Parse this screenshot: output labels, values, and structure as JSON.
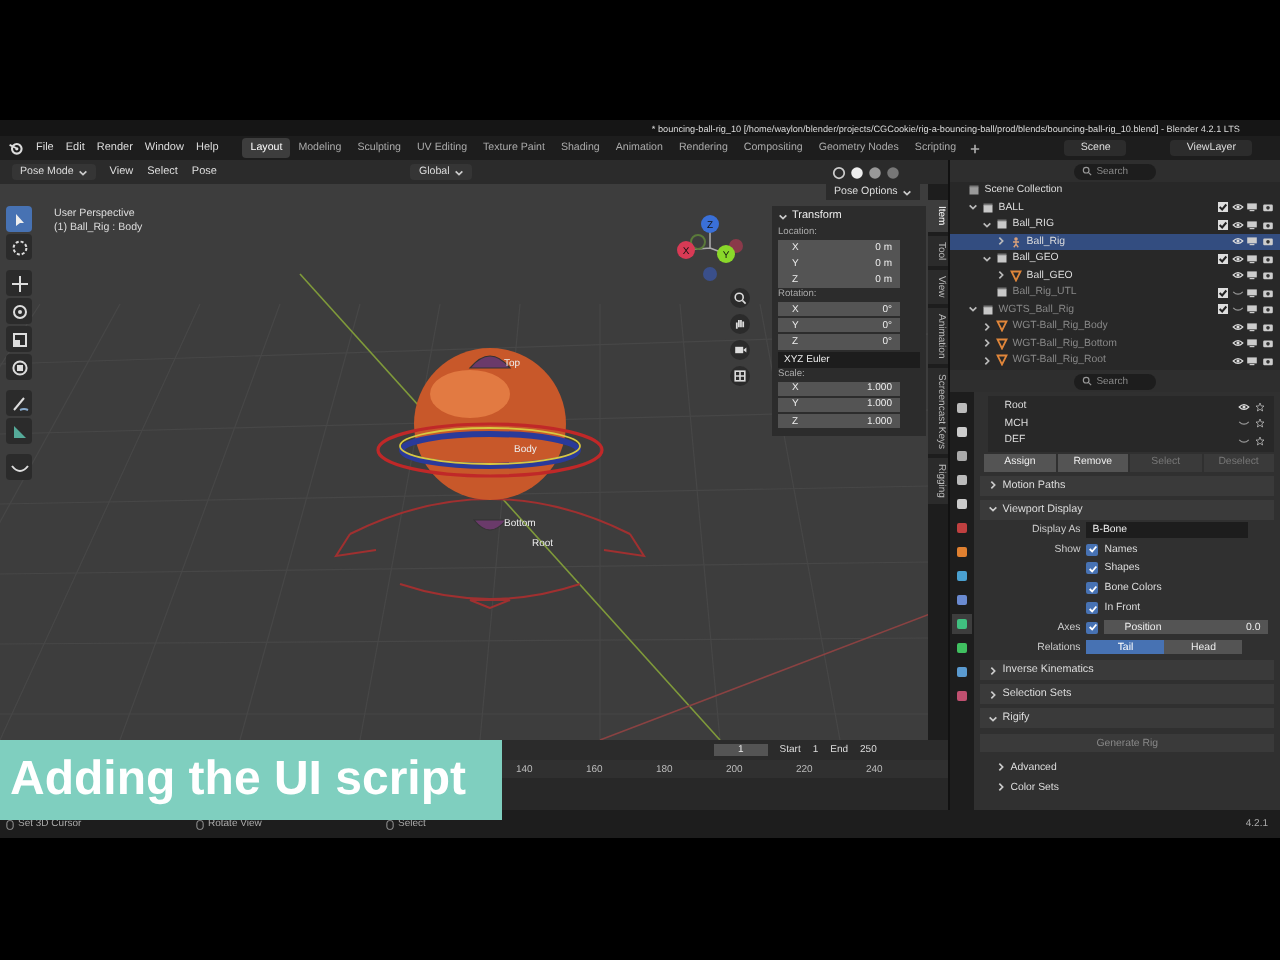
{
  "window": {
    "title": "* bouncing-ball-rig_10 [/home/waylon/blender/projects/CGCookie/rig-a-bouncing-ball/prod/blends/bouncing-ball-rig_10.blend] - Blender 4.2.1 LTS"
  },
  "menu": [
    "File",
    "Edit",
    "Render",
    "Window",
    "Help"
  ],
  "workspaces": [
    {
      "label": "Layout",
      "selected": true
    },
    {
      "label": "Modeling",
      "selected": false
    },
    {
      "label": "Sculpting",
      "selected": false
    },
    {
      "label": "UV Editing",
      "selected": false
    },
    {
      "label": "Texture Paint",
      "selected": false
    },
    {
      "label": "Shading",
      "selected": false
    },
    {
      "label": "Animation",
      "selected": false
    },
    {
      "label": "Rendering",
      "selected": false
    },
    {
      "label": "Compositing",
      "selected": false
    },
    {
      "label": "Geometry Nodes",
      "selected": false
    },
    {
      "label": "Scripting",
      "selected": false
    }
  ],
  "scene": "Scene",
  "view_layer": "ViewLayer",
  "header": {
    "mode": "Pose Mode",
    "menus": [
      "View",
      "Select",
      "Pose"
    ],
    "orientation": "Global",
    "options": "Pose Options"
  },
  "viewport": {
    "overlay": [
      "User Perspective",
      "(1) Ball_Rig : Body"
    ],
    "bone_labels": [
      "Top",
      "Body",
      "Bottom",
      "Root"
    ],
    "gizmo_axes": [
      "Z",
      "X",
      "Y"
    ]
  },
  "transform": {
    "title": "Transform",
    "groups": [
      {
        "label": "Location:",
        "fields": [
          {
            "axis": "X",
            "value": "0 m"
          },
          {
            "axis": "Y",
            "value": "0 m"
          },
          {
            "axis": "Z",
            "value": "0 m"
          }
        ]
      },
      {
        "label": "Rotation:",
        "fields": [
          {
            "axis": "X",
            "value": "0°"
          },
          {
            "axis": "Y",
            "value": "0°"
          },
          {
            "axis": "Z",
            "value": "0°"
          }
        ],
        "mode": "XYZ Euler"
      },
      {
        "label": "Scale:",
        "fields": [
          {
            "axis": "X",
            "value": "1.000"
          },
          {
            "axis": "Y",
            "value": "1.000"
          },
          {
            "axis": "Z",
            "value": "1.000"
          }
        ]
      }
    ]
  },
  "sidebar_tabs": [
    {
      "label": "Item",
      "selected": true
    },
    {
      "label": "Tool",
      "selected": false
    },
    {
      "label": "View",
      "selected": false
    },
    {
      "label": "Animation",
      "selected": false
    },
    {
      "label": "Screencast Keys",
      "selected": false
    },
    {
      "label": "Rigging",
      "selected": false
    }
  ],
  "outliner": {
    "search_placeholder": "Search",
    "items": [
      {
        "label": "Scene Collection",
        "kind": "scene",
        "selected": false,
        "disabled": false,
        "children": [
          {
            "label": "BALL",
            "kind": "collection",
            "selected": false,
            "disabled": false,
            "checked": true,
            "visible": true,
            "expanded": true,
            "children": [
              {
                "label": "Ball_RIG",
                "kind": "collection",
                "selected": false,
                "disabled": false,
                "checked": true,
                "visible": true,
                "expanded": true,
                "children": [
                  {
                    "label": "Ball_Rig",
                    "kind": "armature",
                    "selected": true,
                    "disabled": false,
                    "visible": true,
                    "expanded": false
                  }
                ]
              },
              {
                "label": "Ball_GEO",
                "kind": "collection",
                "selected": false,
                "disabled": false,
                "checked": true,
                "visible": true,
                "expanded": true,
                "children": [
                  {
                    "label": "Ball_GEO",
                    "kind": "mesh",
                    "selected": false,
                    "disabled": false,
                    "visible": true,
                    "expanded": false
                  }
                ]
              },
              {
                "label": "Ball_Rig_UTL",
                "kind": "collection",
                "selected": false,
                "disabled": true,
                "checked": true,
                "visible": false
              }
            ]
          },
          {
            "label": "WGTS_Ball_Rig",
            "kind": "collection",
            "selected": false,
            "disabled": true,
            "checked": true,
            "visible": false,
            "expanded": true,
            "children": [
              {
                "label": "WGT-Ball_Rig_Body",
                "kind": "mesh",
                "selected": false,
                "disabled": true,
                "visible": true,
                "expanded": false
              },
              {
                "label": "WGT-Ball_Rig_Bottom",
                "kind": "mesh",
                "selected": false,
                "disabled": true,
                "visible": true,
                "expanded": false
              },
              {
                "label": "WGT-Ball_Rig_Root",
                "kind": "mesh",
                "selected": false,
                "disabled": true,
                "visible": true,
                "expanded": false
              }
            ]
          }
        ]
      }
    ]
  },
  "properties": {
    "search_placeholder": "Search",
    "bone_collections": [
      {
        "label": "Root",
        "visible": true
      },
      {
        "label": "MCH",
        "visible": false
      },
      {
        "label": "DEF",
        "visible": false
      }
    ],
    "collection_buttons": [
      {
        "label": "Assign",
        "disabled": false
      },
      {
        "label": "Remove",
        "disabled": false
      },
      {
        "label": "Select",
        "disabled": true
      },
      {
        "label": "Deselect",
        "disabled": true
      }
    ],
    "panels": [
      {
        "title": "Motion Paths",
        "expanded": false
      },
      {
        "title": "Viewport Display",
        "expanded": true,
        "display_as": {
          "label": "Display As",
          "value": "B-Bone"
        },
        "show_label": "Show",
        "show": [
          {
            "label": "Names",
            "checked": true
          },
          {
            "label": "Shapes",
            "checked": true
          },
          {
            "label": "Bone Colors",
            "checked": true
          },
          {
            "label": "In Front",
            "checked": true
          }
        ],
        "axes": {
          "label": "Axes",
          "checked": true,
          "field_label": "Position",
          "value": "0.0"
        },
        "relations": {
          "label": "Relations",
          "options": [
            {
              "label": "Tail",
              "selected": true
            },
            {
              "label": "Head",
              "selected": false
            }
          ]
        }
      },
      {
        "title": "Inverse Kinematics",
        "expanded": false
      },
      {
        "title": "Selection Sets",
        "expanded": false
      },
      {
        "title": "Rigify",
        "expanded": true,
        "button": "Generate Rig",
        "subpanels": [
          "Advanced",
          "Color Sets"
        ]
      }
    ]
  },
  "timeline": {
    "frame": "1",
    "start_label": "Start",
    "start": "1",
    "end_label": "End",
    "end": "250",
    "ticks": [
      "140",
      "160",
      "180",
      "200",
      "220",
      "240"
    ]
  },
  "caption": "Adding the UI script",
  "status_bar": {
    "hints": [
      "Set 3D Cursor",
      "Rotate View",
      "Select"
    ],
    "version": "4.2.1"
  }
}
